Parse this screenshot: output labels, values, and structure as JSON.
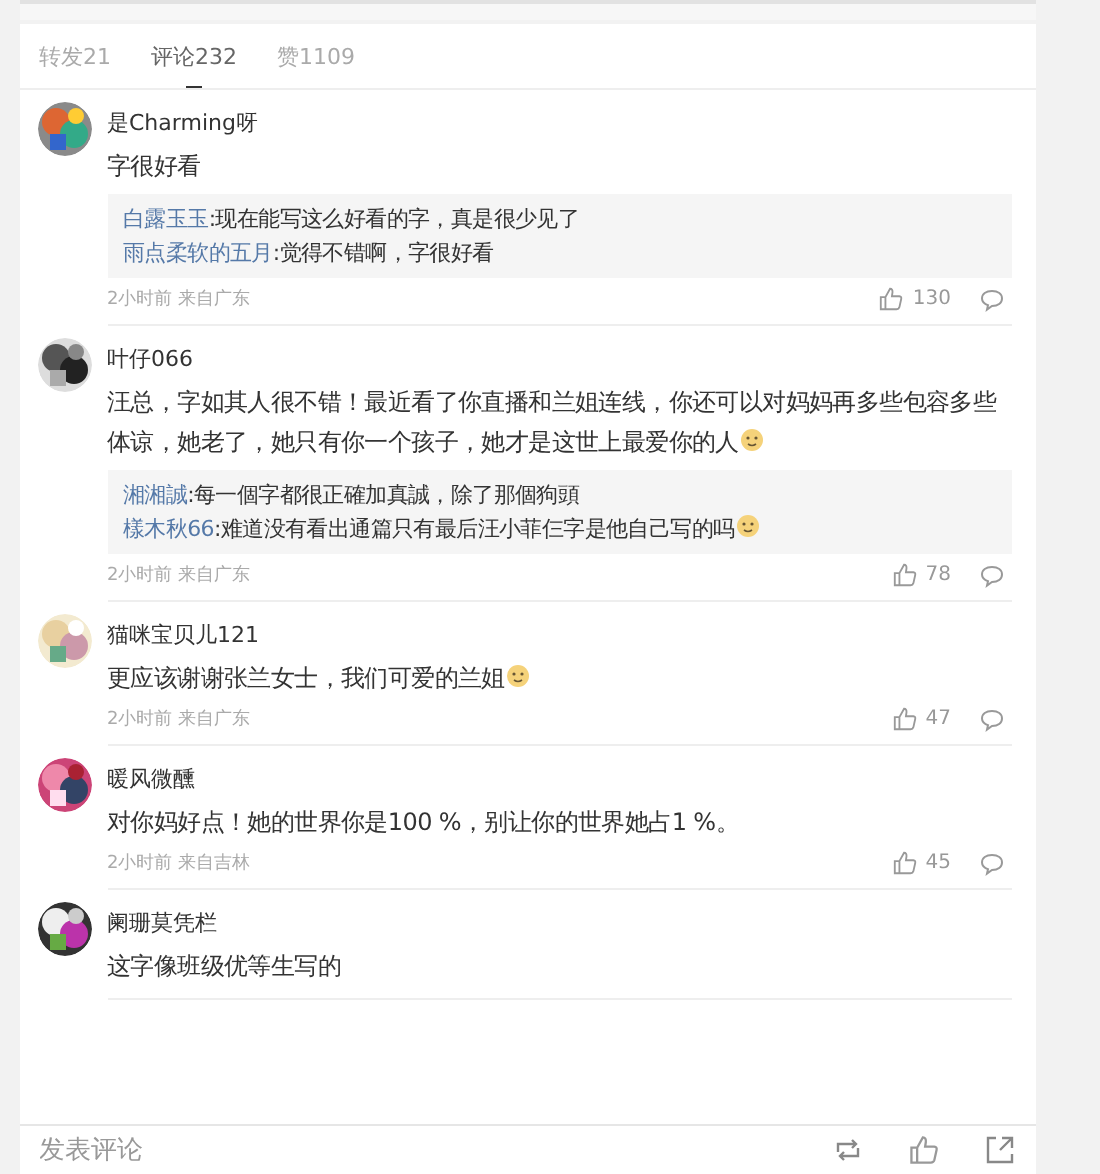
{
  "tabs": [
    {
      "label": "转发21",
      "selected": false
    },
    {
      "label": "评论232",
      "selected": true
    },
    {
      "label": "赞1109",
      "selected": false
    }
  ],
  "comments": [
    {
      "user": "是Charming呀",
      "text": "字很好看",
      "emoji": false,
      "replies": [
        {
          "user": "白露玉玉",
          "text": ":现在能写这么好看的字，真是很少见了",
          "emoji": false
        },
        {
          "user": "雨点柔软的五月",
          "text": ":觉得不错啊，字很好看",
          "emoji": false
        }
      ],
      "meta": "2小时前 来自广东",
      "likes": "130"
    },
    {
      "user": "叶仔066",
      "text": "汪总，字如其人很不错！最近看了你直播和兰姐连线，你还可以对妈妈再多些包容多些体谅，她老了，她只有你一个孩子，她才是这世上最爱你的人",
      "emoji": true,
      "replies": [
        {
          "user": "湘湘誠",
          "text": ":每一個字都很正確加真誠，除了那個狗頭",
          "emoji": false
        },
        {
          "user": "樣木秋66",
          "text": ":难道没有看出通篇只有最后汪小菲仨字是他自己写的吗",
          "emoji": true
        }
      ],
      "meta": "2小时前 来自广东",
      "likes": "78"
    },
    {
      "user": "猫咪宝贝儿121",
      "text": "更应该谢谢张兰女士，我们可爱的兰姐",
      "emoji": true,
      "meta": "2小时前 来自广东",
      "likes": "47"
    },
    {
      "user": "暖风微醺",
      "text": "对你妈好点！她的世界你是100 %，别让你的世界她占1 %。",
      "emoji": false,
      "meta": "2小时前 来自吉林",
      "likes": "45"
    },
    {
      "user": "阑珊莫凭栏",
      "text": "这字像班级优等生写的",
      "emoji": false
    }
  ],
  "composer": {
    "placeholder": "发表评论"
  }
}
